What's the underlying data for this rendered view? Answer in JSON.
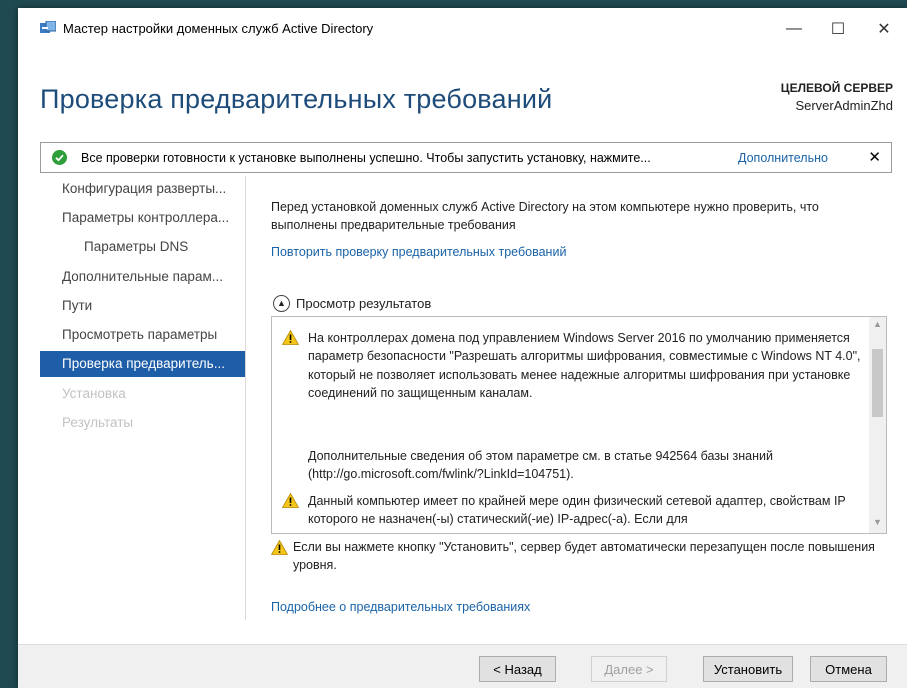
{
  "window": {
    "title": "Мастер настройки доменных служб Active Directory",
    "controls": {
      "minimize": "—",
      "maximize": "☐",
      "close": "✕"
    }
  },
  "header": {
    "page_title": "Проверка предварительных требований",
    "target_label": "ЦЕЛЕВОЙ СЕРВЕР",
    "target_name": "ServerAdminZhd"
  },
  "notification": {
    "message": "Все проверки готовности к установке выполнены успешно.  Чтобы запустить установку, нажмите...",
    "more_link": "Дополнительно",
    "close": "✕",
    "status_color": "#2e9e3a"
  },
  "nav": {
    "items": [
      {
        "label": "Конфигурация разверты...",
        "state": "normal"
      },
      {
        "label": "Параметры контроллера...",
        "state": "normal"
      },
      {
        "label": "Параметры DNS",
        "state": "sub"
      },
      {
        "label": "Дополнительные парам...",
        "state": "normal"
      },
      {
        "label": "Пути",
        "state": "normal"
      },
      {
        "label": "Просмотреть параметры",
        "state": "normal"
      },
      {
        "label": "Проверка предваритель...",
        "state": "active"
      },
      {
        "label": "Установка",
        "state": "disabled"
      },
      {
        "label": "Результаты",
        "state": "disabled"
      }
    ],
    "accent_color": "#1e5ea8"
  },
  "content": {
    "intro": "Перед установкой доменных служб Active Directory на этом компьютере нужно проверить, что выполнены предварительные требования",
    "recheck_link": "Повторить проверку предварительных требований",
    "review_header": "Просмотр результатов",
    "results": [
      {
        "icon": "warning-icon",
        "text": "На контроллерах домена под управлением Windows Server 2016 по умолчанию применяется параметр безопасности \"Разрешать алгоритмы шифрования, совместимые с Windows NT 4.0\", который не позволяет использовать менее надежные алгоритмы шифрования при установке соединений по защищенным каналам."
      },
      {
        "icon": "none",
        "text": "Дополнительные сведения об этом параметре см. в статье 942564 базы знаний (http://go.microsoft.com/fwlink/?LinkId=104751)."
      },
      {
        "icon": "warning-icon",
        "text": "Данный компьютер имеет по крайней мере один физический сетевой адаптер, свойствам IP которого не назначен(-ы) статический(-ие) IP-адрес(-а). Если для"
      }
    ],
    "restart_note": "Если вы нажмете кнопку \"Установить\", сервер будет автоматически перезапущен после повышения уровня.",
    "learn_more_link": "Подробнее о предварительных требованиях"
  },
  "footer": {
    "back": "< Назад",
    "next": "Далее >",
    "install": "Установить",
    "cancel": "Отмена"
  }
}
